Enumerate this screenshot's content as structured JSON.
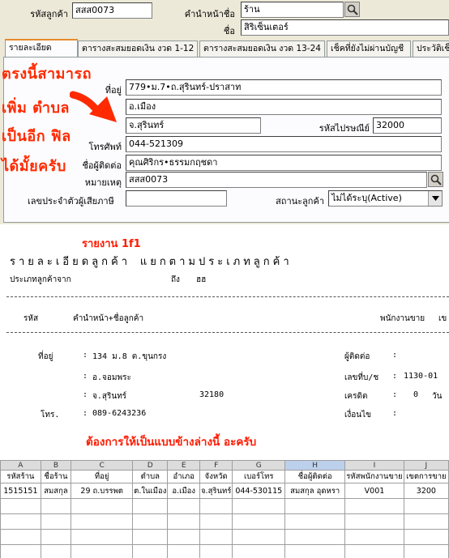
{
  "form": {
    "customer_code_label": "รหัสลูกค้า",
    "customer_code_value": "สสส0073",
    "prefix_label": "คำนำหน้าชื่อ",
    "prefix_value": "ร้าน",
    "name_label": "ชื่อ",
    "name_value": "สิริเซ็นเตอร์",
    "tabs": [
      {
        "label": "รายละเอียด"
      },
      {
        "label": "ตารางสะสมยอดเงิน งวด 1-12"
      },
      {
        "label": "ตารางสะสมยอดเงิน งวด 13-24"
      },
      {
        "label": "เช็คที่ยังไม่ผ่านบัญชี"
      },
      {
        "label": "ประวัติเช็"
      }
    ],
    "address_label": "ที่อยู่",
    "address_line1": "779•ม.7•ถ.สุรินทร์-ปราสาท",
    "address_line2": "อ.เมือง",
    "address_line3": "จ.สุรินทร์",
    "postal_label": "รหัสไปรษณีย์",
    "postal_value": "32000",
    "phone_label": "โทรศัพท์",
    "phone_value": "044-521309",
    "contact_label": "ชื่อผู้ติดต่อ",
    "contact_value": "คุณศิริกร•ธรรมกฤชดา",
    "note_label": "หมายเหตุ",
    "note_value": "สสส0073",
    "taxid_label": "เลขประจำตัวผู้เสียภาษี",
    "taxid_value": "",
    "status_label": "สถานะลูกค้า",
    "status_value": "ไม่ได้ระบุ(Active)",
    "annotation_lines": [
      "ตรงนี้สามารถ",
      "เพิ่ม ตำบล",
      "เป็นอีก ฟิล",
      "ได้มั้ยครับ"
    ]
  },
  "report": {
    "report_id": "รายงาน 1f1",
    "title": "รายละเอียดลูกค้า แยกตามประเภทลูกค้า",
    "filter_from_label": "ประเภทลูกค้าจาก",
    "filter_to_label": "ถึง",
    "filter_to_value": "ฮฮ",
    "col_code": "รหัส",
    "col_name": "คำนำหน้า+ชื่อลูกค้า",
    "col_salesman": "พนักงานขาย",
    "col_cut": "เข",
    "address_label": "ที่อยู่",
    "address_line1": "134 ม.8 ต.ขุนกรง",
    "address_line2": "อ.จอมพระ",
    "address_line3": "จ.สุรินทร์",
    "postal_value": "32180",
    "phone_label": "โทร.",
    "phone_value": "089-6243236",
    "contact_label": "ผู้ติดต่อ",
    "contact_value": ":",
    "tax_label": "เลขที่บ/ช",
    "tax_value": "1130-01",
    "credit_label": "เครดิต",
    "credit_value": "0",
    "credit_unit": "วัน",
    "condition_label": "เงื่อนไข",
    "request_text": "ต้องการให้เป็นแบบข้างล่างนี้ อะครับ"
  },
  "sheet": {
    "col_letters": [
      "A",
      "B",
      "C",
      "D",
      "E",
      "F",
      "G",
      "H",
      "I",
      "J"
    ],
    "headers": [
      "รหัสร้าน",
      "ชื่อร้าน",
      "ที่อยู่",
      "ตำบล",
      "อำเภอ",
      "จังหวัด",
      "เบอร์โทร",
      "ชื่อผู้ติดต่อ",
      "รหัสพนักงานขาย",
      "เขตการขาย"
    ],
    "rows": [
      [
        "1515151",
        "สมสกุล",
        "29 ถ.บรรพต",
        "ต.ในเมือง",
        "อ.เมือง",
        "จ.สุรินทร์",
        "044-530115",
        "สมสกุล อุดหรา",
        "V001",
        "3200"
      ]
    ]
  },
  "colors": {
    "annotation": "#ff2a00",
    "tab_highlight": "#e68b2c",
    "panel_bg": "#ece9d8"
  }
}
